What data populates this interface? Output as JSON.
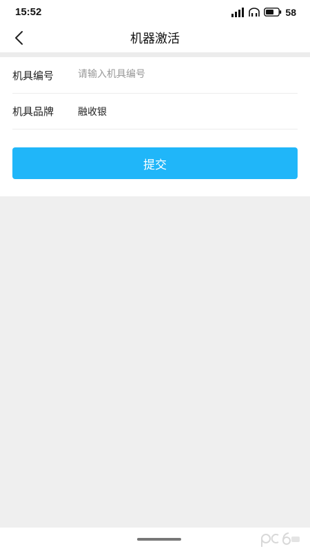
{
  "status_bar": {
    "time": "15:52",
    "battery_level": "58",
    "icons": [
      "signal-icon",
      "hd-icon",
      "battery-icon"
    ]
  },
  "header": {
    "title": "机器激活",
    "back_icon": "chevron-left-icon"
  },
  "form": {
    "device_number": {
      "label": "机具编号",
      "placeholder": "请输入机具编号",
      "value": ""
    },
    "device_brand": {
      "label": "机具品牌",
      "value": "融收银"
    },
    "submit_label": "提交"
  },
  "colors": {
    "accent": "#20b6f9",
    "background": "#efefef",
    "card": "#ffffff",
    "placeholder": "#999999"
  }
}
